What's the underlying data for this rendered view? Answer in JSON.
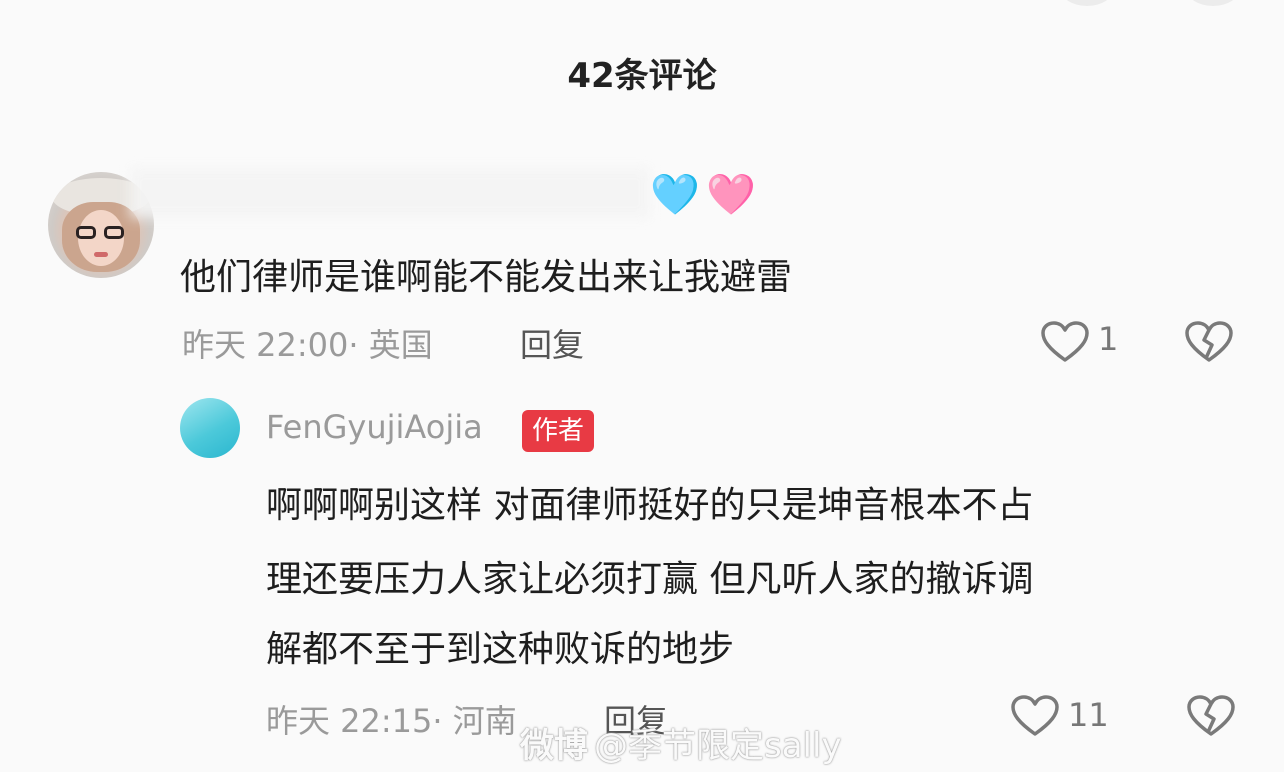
{
  "header": {
    "title": "42条评论"
  },
  "comments": [
    {
      "username": "",
      "emojis": [
        "🩵",
        "🩷"
      ],
      "text": "他们律师是谁啊能不能发出来让我避雷",
      "meta": "昨天 22:00· 英国",
      "reply_label": "回复",
      "like_count": "1"
    }
  ],
  "replies": [
    {
      "username": "FenGyujiAojia",
      "badge": "作者",
      "text_lines": [
        "啊啊啊别这样 对面律师挺好的只是坤音根本不占",
        "理还要压力人家让必须打赢 但凡听人家的撤诉调",
        "解都不至于到这种败诉的地步"
      ],
      "meta": "昨天 22:15· 河南",
      "reply_label": "回复",
      "like_count": "11"
    }
  ],
  "watermark": {
    "logo": "微博",
    "text": "@季节限定sally"
  },
  "colors": {
    "badge": "#e83a44",
    "meta_gray": "#9a9a9a",
    "text": "#1e1e1e"
  },
  "icons": [
    "heart-outline-icon",
    "broken-heart-icon"
  ]
}
